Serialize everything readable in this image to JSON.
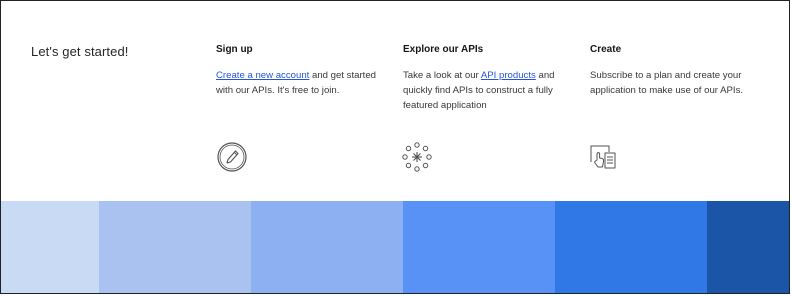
{
  "intro": {
    "heading": "Let's get started!"
  },
  "columns": [
    {
      "title": "Sign up",
      "link": "Create a new account",
      "text_after": " and get started with our APIs. It's free to join.",
      "icon": "pencil-circle-icon"
    },
    {
      "title": "Explore our APIs",
      "text_before": "Take a look at our ",
      "link": "API products",
      "text_after": " and quickly find APIs to construct a fully featured application",
      "icon": "network-burst-icon"
    },
    {
      "title": "Create",
      "text": "Subscribe to a plan and create your application to make use of our APIs.",
      "icon": "app-create-icon"
    }
  ],
  "colors": {
    "accent": "#4466dd",
    "link": "#2455d8",
    "bands": [
      "#c8daf4",
      "#a9c2f0",
      "#8cb0f1",
      "#5892f7",
      "#2f78e6",
      "#1a55a8"
    ]
  }
}
